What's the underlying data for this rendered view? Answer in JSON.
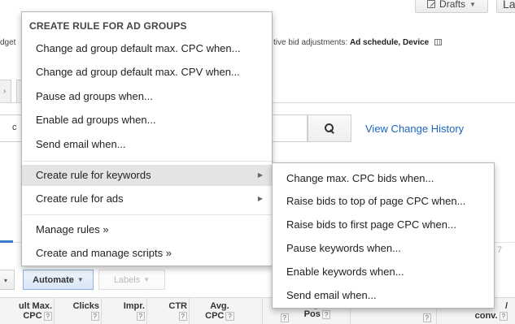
{
  "header": {
    "drafts_label": "Drafts",
    "la_label": "La"
  },
  "summary": {
    "budget_fragment": "dget",
    "adjust_prefix": "tive bid adjustments:",
    "adjust_value": "Ad schedule, Device"
  },
  "tabs": {
    "stub_char": "›"
  },
  "filter": {
    "stub_label": "c",
    "view_history_label": "View Change History"
  },
  "table_meta": {
    "right_count": "7"
  },
  "toolbar": {
    "stub_caret": "▾",
    "automate_label": "Automate",
    "labels_label": "Labels"
  },
  "columns": [
    {
      "line1": "ult Max.",
      "line2": "CPC"
    },
    {
      "line1": "Clicks",
      "line2": ""
    },
    {
      "line1": "Impr.",
      "line2": ""
    },
    {
      "line1": "CTR",
      "line2": ""
    },
    {
      "line1": "Avg.",
      "line2": "CPC"
    },
    {
      "line1": "",
      "line2": ""
    },
    {
      "line1": "g.",
      "line2": "Pos"
    },
    {
      "line1": "",
      "line2": ""
    },
    {
      "line1": "/",
      "line2": "conv."
    }
  ],
  "main_menu": {
    "header": "CREATE RULE FOR AD GROUPS",
    "items": [
      "Change ad group default max. CPC when...",
      "Change ad group default max. CPV when...",
      "Pause ad groups when...",
      "Enable ad groups when...",
      "Send email when...",
      "Create rule for keywords",
      "Create rule for ads",
      "Manage rules »",
      "Create and manage scripts »"
    ]
  },
  "sub_menu": {
    "items": [
      "Change max. CPC bids when...",
      "Raise bids to top of page CPC when...",
      "Raise bids to first page CPC when...",
      "Pause keywords when...",
      "Enable keywords when...",
      "Send email when..."
    ]
  },
  "colors": {
    "link": "#1a65c0",
    "highlight": "#e4e4e4",
    "automate_border": "#8fb1de",
    "tab_underline": "#3b78c7"
  }
}
